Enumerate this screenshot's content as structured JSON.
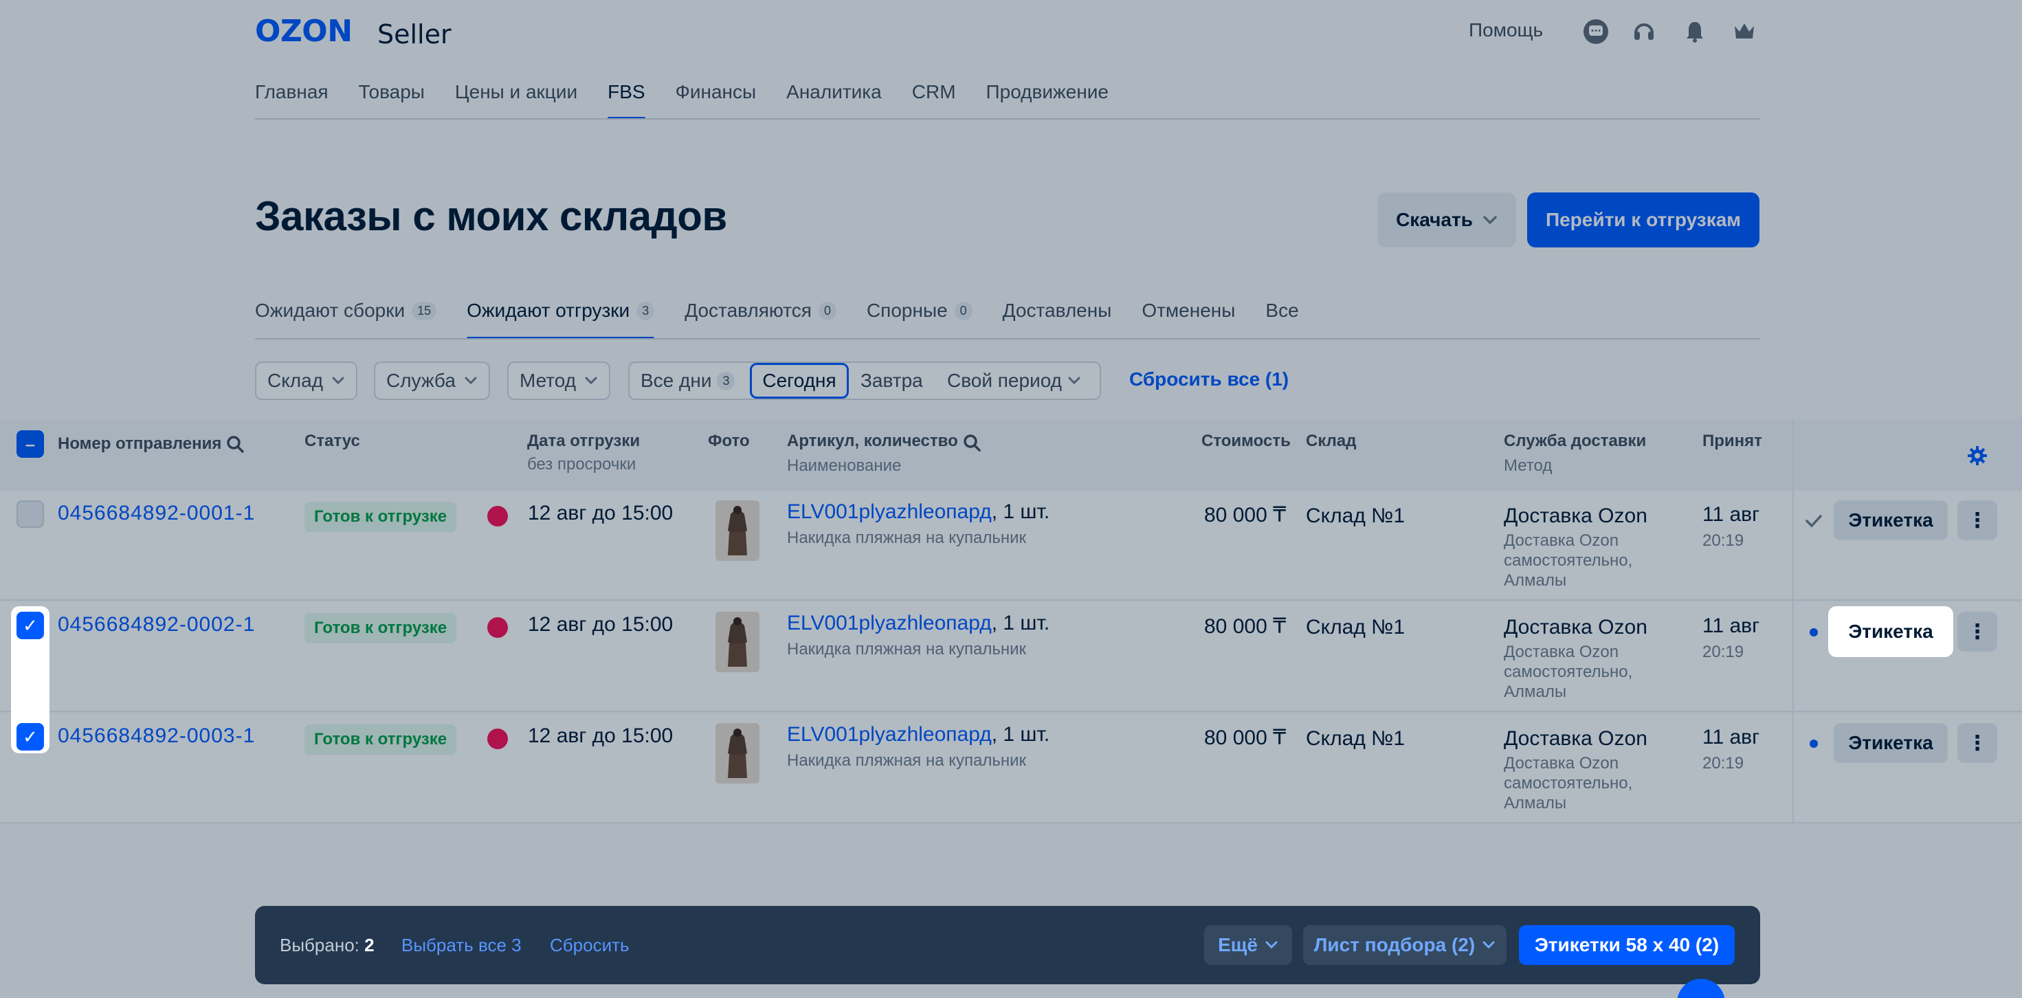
{
  "header": {
    "logo": "OZON",
    "logo_sub": "Seller",
    "help": "Помощь"
  },
  "nav": {
    "items": [
      "Главная",
      "Товары",
      "Цены и акции",
      "FBS",
      "Финансы",
      "Аналитика",
      "CRM",
      "Продвижение"
    ],
    "active": "FBS"
  },
  "page": {
    "title": "Заказы с моих складов",
    "download_label": "Скачать",
    "go_shipments_label": "Перейти к отгрузкам"
  },
  "tabs": [
    {
      "label": "Ожидают сборки",
      "count": "15"
    },
    {
      "label": "Ожидают отгрузки",
      "count": "3"
    },
    {
      "label": "Доставляются",
      "count": "0"
    },
    {
      "label": "Спорные",
      "count": "0"
    },
    {
      "label": "Доставлены",
      "count": ""
    },
    {
      "label": "Отменены",
      "count": ""
    },
    {
      "label": "Все",
      "count": ""
    }
  ],
  "filters": {
    "warehouse": "Склад",
    "service": "Служба",
    "method": "Метод",
    "all_days": "Все дни",
    "all_days_count": "3",
    "today": "Сегодня",
    "tomorrow": "Завтра",
    "custom_period": "Свой период",
    "reset_all": "Сбросить все (1)"
  },
  "table": {
    "headers": {
      "number": "Номер отправления",
      "status": "Статус",
      "ship_date": "Дата отгрузки",
      "ship_date_sub": "без просрочки",
      "photo": "Фото",
      "sku": "Артикул, количество",
      "sku_sub": "Наименование",
      "price": "Стоимость",
      "warehouse": "Склад",
      "delivery": "Служба доставки",
      "delivery_sub": "Метод",
      "accepted": "Принят"
    },
    "rows": [
      {
        "number": "0456684892-0001-1",
        "status": "Готов к отгрузке",
        "ship_date": "12 авг до 15:00",
        "sku": "ELV001plyazhleопард",
        "qty": ", 1 шт.",
        "name": "Накидка пляжная на купальник",
        "price": "80 000 ₸",
        "warehouse": "Склад №1",
        "delivery": "Доставка Ozon",
        "method_1": "Доставка Ozon",
        "method_2": "самостоятельно,",
        "method_3": "Алмалы",
        "accepted_date": "11 авг",
        "accepted_time": "20:19",
        "label_btn": "Этикетка",
        "checked": false
      },
      {
        "number": "0456684892-0002-1",
        "status": "Готов к отгрузке",
        "ship_date": "12 авг до 15:00",
        "sku": "ELV001plyazhleопард",
        "qty": ", 1 шт.",
        "name": "Накидка пляжная на купальник",
        "price": "80 000 ₸",
        "warehouse": "Склад №1",
        "delivery": "Доставка Ozon",
        "method_1": "Доставка Ozon",
        "method_2": "самостоятельно,",
        "method_3": "Алмалы",
        "accepted_date": "11 авг",
        "accepted_time": "20:19",
        "label_btn": "Этикетка",
        "checked": true
      },
      {
        "number": "0456684892-0003-1",
        "status": "Готов к отгрузке",
        "ship_date": "12 авг до 15:00",
        "sku": "ELV001plyazhleопард",
        "qty": ", 1 шт.",
        "name": "Накидка пляжная на купальник",
        "price": "80 000 ₸",
        "warehouse": "Склад №1",
        "delivery": "Доставка Ozon",
        "method_1": "Доставка Ozon",
        "method_2": "самостоятельно,",
        "method_3": "Алмалы",
        "accepted_date": "11 авг",
        "accepted_time": "20:19",
        "label_btn": "Этикетка",
        "checked": true
      }
    ]
  },
  "bottom_bar": {
    "selected_label": "Выбрано:",
    "selected_count": "2",
    "select_all": "Выбрать все 3",
    "reset": "Сбросить",
    "more": "Ещё",
    "pick_list": "Лист подбора (2)",
    "labels": "Этикетки 58 х 40 (2)"
  },
  "colors": {
    "accent": "#005bff",
    "text": "#001a34",
    "status_green": "#00a046",
    "overlay": "rgba(0,26,52,0.3)"
  }
}
